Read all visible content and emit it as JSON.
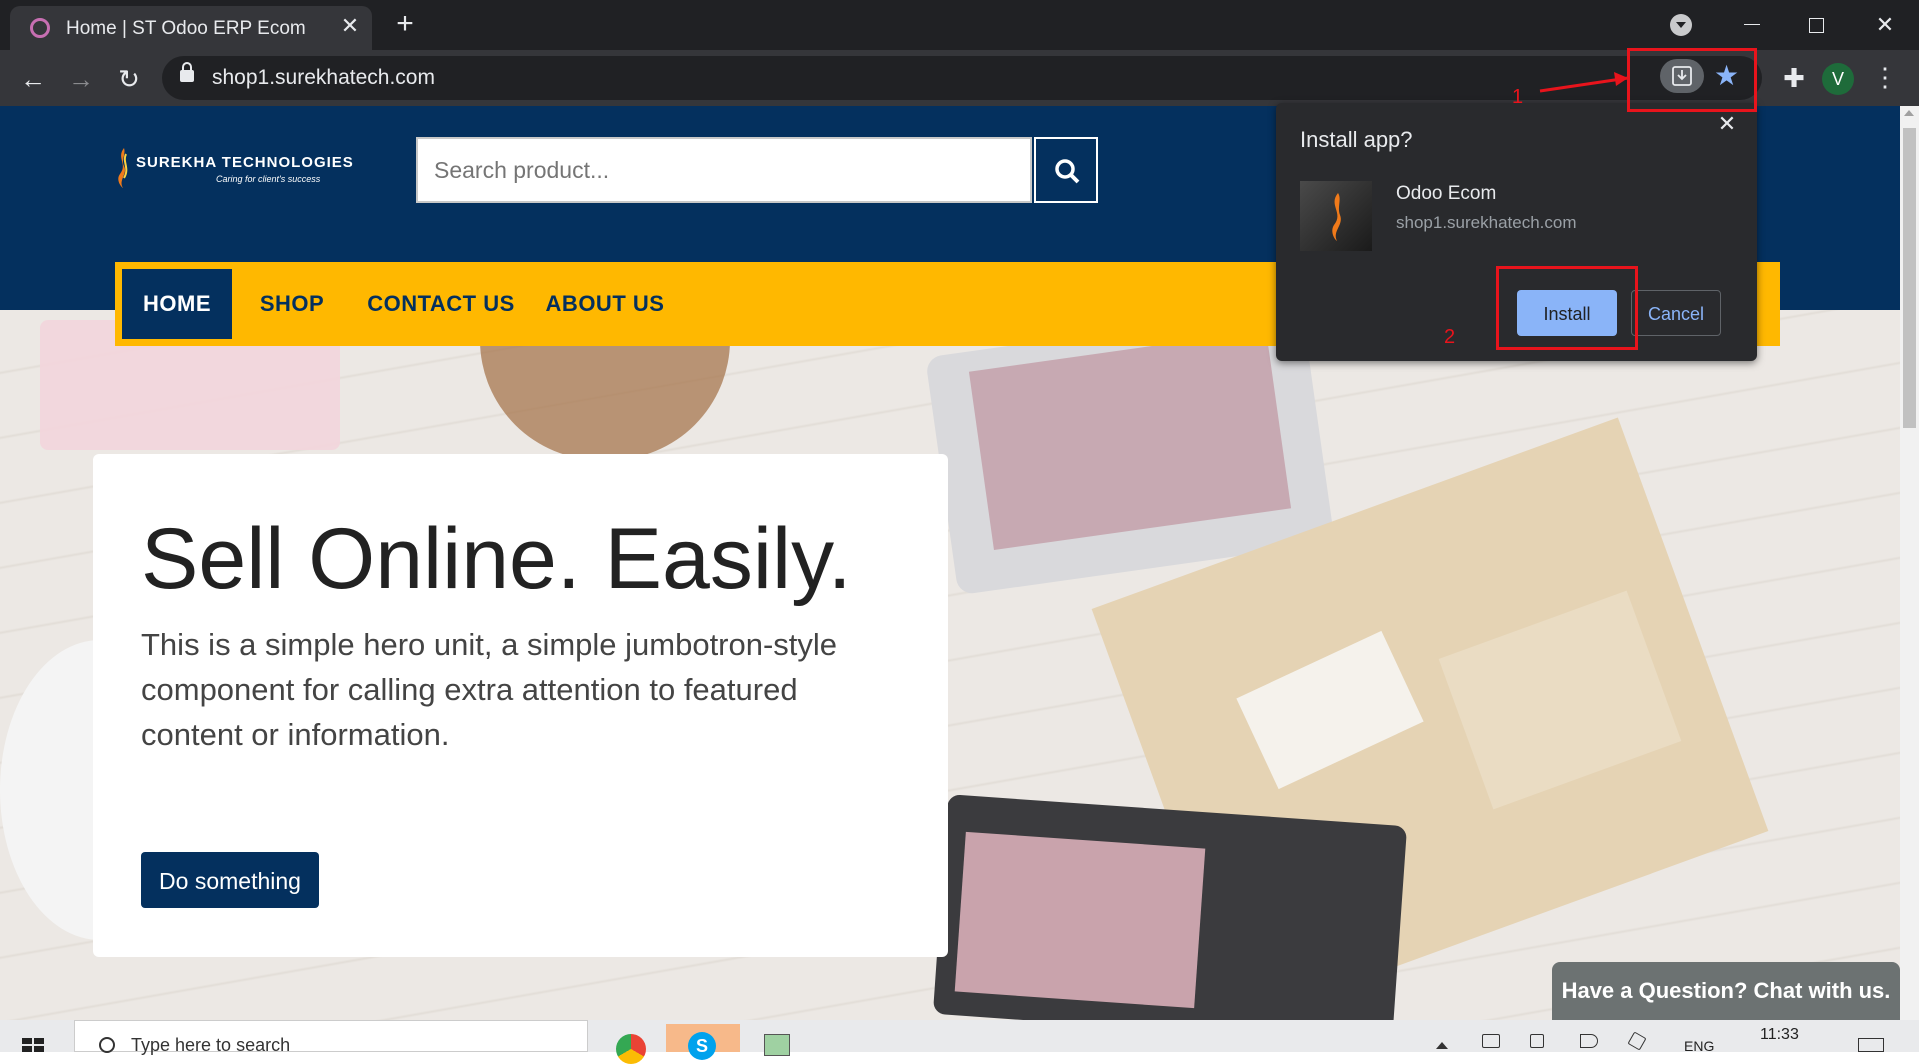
{
  "browser": {
    "tab_title": "Home | ST Odoo ERP Ecom",
    "url": "shop1.surekhatech.com",
    "profile_initial": "V"
  },
  "site": {
    "logo_name": "SUREKHA TECHNOLOGIES",
    "logo_tagline": "Caring for client's success",
    "search_placeholder": "Search product...",
    "nav": [
      "HOME",
      "SHOP",
      "CONTACT US",
      "ABOUT US"
    ],
    "hero": {
      "title": "Sell Online. Easily.",
      "text": "This is a simple hero unit, a simple jumbotron-style component for calling extra attention to featured content or information.",
      "cta": "Do something"
    },
    "chat": "Have a Question? Chat with us."
  },
  "install_popup": {
    "title": "Install app?",
    "app_name": "Odoo Ecom",
    "origin": "shop1.surekhatech.com",
    "install": "Install",
    "cancel": "Cancel"
  },
  "annotations": [
    "1",
    "2"
  ],
  "taskbar": {
    "search_text": "Type here to search",
    "lang": "ENG",
    "time": "11:33"
  },
  "colors": {
    "header_blue": "#04305e",
    "nav_yellow": "#ffb800",
    "annotation_red": "#e8141c",
    "popup_bg": "#292a2d",
    "install_blue": "#8ab4f8"
  },
  "icons": [
    "tab-favicon",
    "close-icon",
    "plus-icon",
    "back-icon",
    "forward-icon",
    "reload-icon",
    "lock-icon",
    "install-app-icon",
    "star-icon",
    "puzzle-icon",
    "kebab-menu-icon",
    "search-icon",
    "windows-start-icon"
  ]
}
